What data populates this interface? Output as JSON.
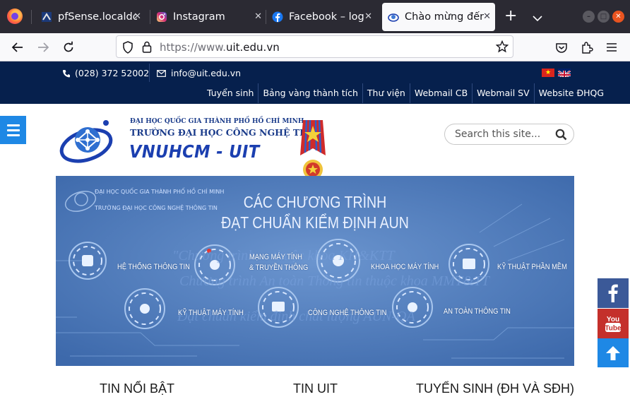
{
  "browser": {
    "tabs": [
      {
        "label": "pfSense.localdomain",
        "icon": "pfsense-icon"
      },
      {
        "label": "Instagram",
        "icon": "instagram-icon"
      },
      {
        "label": "Facebook – log in or sign up",
        "icon": "facebook-icon"
      },
      {
        "label": "Chào mừng đến với UIT",
        "icon": "uit-favicon-icon",
        "active": true
      }
    ],
    "url_protocol": "https://www.",
    "url_domain": "uit.edu.vn"
  },
  "site": {
    "phone": "(028) 372 52002",
    "email": "info@uit.edu.vn",
    "top_links": [
      "Tuyển sinh",
      "Bảng vàng thành tích",
      "Thư viện",
      "Webmail CB",
      "Webmail SV",
      "Website ĐHQG"
    ],
    "uni_line1": "ĐẠI HỌC QUỐC GIA THÀNH PHỐ HỒ CHÍ MINH",
    "uni_line2": "TRƯỜNG ĐẠI HỌC CÔNG NGHỆ THÔNG TIN",
    "uni_short": "VNUHCM - UIT",
    "search_placeholder": "Search this site..."
  },
  "banner": {
    "small1": "ĐẠI HỌC QUỐC GIA THÀNH PHỐ HỒ CHÍ MINH",
    "small2": "TRƯỜNG ĐẠI HỌC CÔNG NGHỆ THÔNG TIN",
    "title1": "CÁC CHƯƠNG TRÌNH",
    "title2": "ĐẠT CHUẨN KIỂM ĐỊNH AUN",
    "programs": [
      "HỆ THỐNG THÔNG TIN",
      "MẠNG MÁY TÍNH",
      "& TRUYỀN THÔNG",
      "KHOA HỌC MÁY TÍNH",
      "KỸ THUẬT PHẦN MỀM",
      "KỸ THUẬT MÁY TÍNH",
      "CÔNG NGHỆ THÔNG TIN",
      "AN TOÀN THÔNG TIN"
    ],
    "ghost1": "\"Chương trình ... thuộc khoa KH&KTT",
    "ghost2": "Chương trình An toàn Thông tin thuộc khoa MMT&TT",
    "ghost3": "Đạt chuẩn kiểm định chất lượng AUN-QA"
  },
  "sections": [
    "TIN NỔI BẬT",
    "TIN UIT",
    "TUYỂN SINH (ĐH VÀ SĐH)"
  ],
  "colors": {
    "top_bar": "#06204d",
    "menu_button": "#1e88e5",
    "banner_bg": "#4a78b8",
    "facebook": "#3b5998",
    "youtube": "#c4302b",
    "scroll_top": "#1e88e5"
  }
}
